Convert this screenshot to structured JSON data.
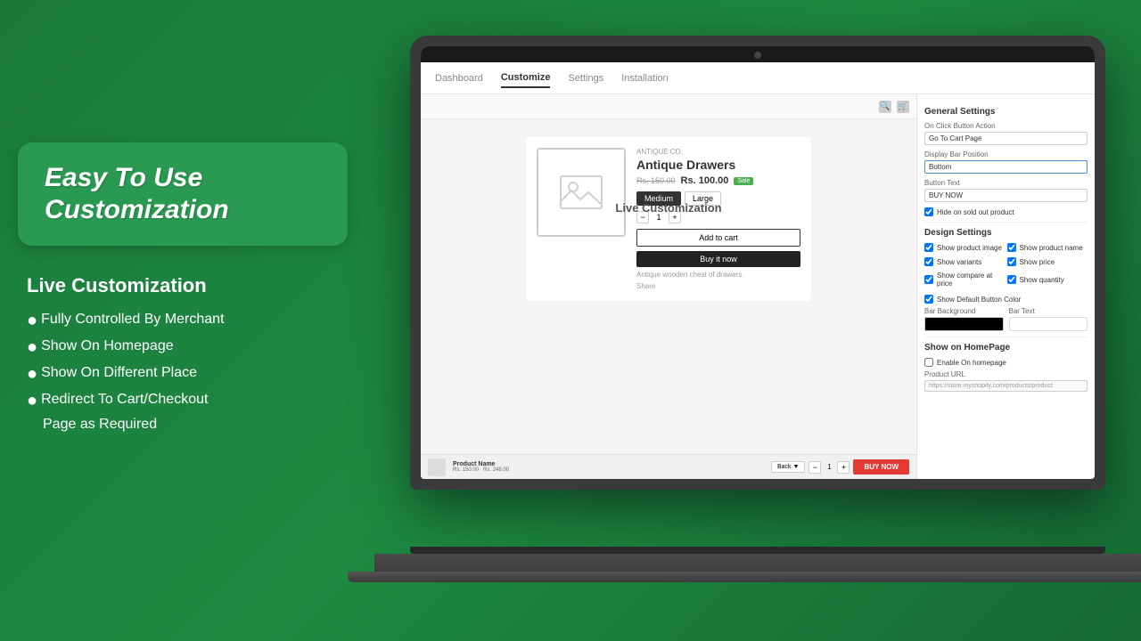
{
  "background": {
    "color": "#1a7a3c"
  },
  "headline": {
    "text": "Easy To Use Customization"
  },
  "features": {
    "title": "Live Customization",
    "items": [
      "Fully Controlled By Merchant",
      "Show On Homepage",
      "Show On Different Place",
      "Redirect To Cart/Checkout Page as Required"
    ],
    "bullets": [
      "●",
      "●",
      "●",
      "●"
    ]
  },
  "app": {
    "nav": {
      "tabs": [
        "Dashboard",
        "Customize",
        "Settings",
        "Installation"
      ],
      "active": "Customize"
    },
    "preview": {
      "live_label": "Live Customization",
      "product": {
        "eyebrow": "ANTIQUE CO.",
        "name": "Antique Drawers",
        "original_price": "Rs. 150.00",
        "sale_price": "Rs. 100.00",
        "sale_badge": "Sale",
        "sizes": [
          "Medium",
          "Large"
        ],
        "selected_size": "Medium",
        "quantity": "1",
        "add_to_cart": "Add to cart",
        "buy_now": "Buy it now",
        "description": "Antique wooden chest of drawers.",
        "share": "Share"
      },
      "sticky_bar": {
        "product_name": "Product Name",
        "original_price": "Rs. 150.00",
        "sale_price": "Rs. 248.00",
        "nav_label": "Back",
        "quantity": "1",
        "buy_button": "BUY NOW"
      }
    },
    "settings_panel": {
      "general_title": "General Settings",
      "on_click_label": "On Click Button Action",
      "on_click_value": "Go To Cart Page",
      "display_bar_label": "Display Bar Position",
      "display_bar_value": "Bottom",
      "button_text_label": "Button Text",
      "button_text_value": "BUY NOW",
      "hide_sold_out": "Hide on sold out product",
      "design_title": "Design Settings",
      "design_checkboxes": [
        {
          "label": "Show product image",
          "checked": true
        },
        {
          "label": "Show product name",
          "checked": true
        },
        {
          "label": "Show variants",
          "checked": true
        },
        {
          "label": "Show price",
          "checked": true
        },
        {
          "label": "Show compare at price",
          "checked": true
        },
        {
          "label": "Show quantity",
          "checked": true
        },
        {
          "label": "Show Default Button Color",
          "checked": true
        }
      ],
      "bar_background_label": "Bar Background",
      "bar_text_label": "Bar Text",
      "bar_bg_color": "#000000",
      "bar_text_color": "#ffffff",
      "show_homepage_title": "Show on HomePage",
      "enable_homepage": "Enable On homepage",
      "product_url_label": "Product URL",
      "product_url_value": "https://store.myshopify.com/products/product"
    }
  }
}
